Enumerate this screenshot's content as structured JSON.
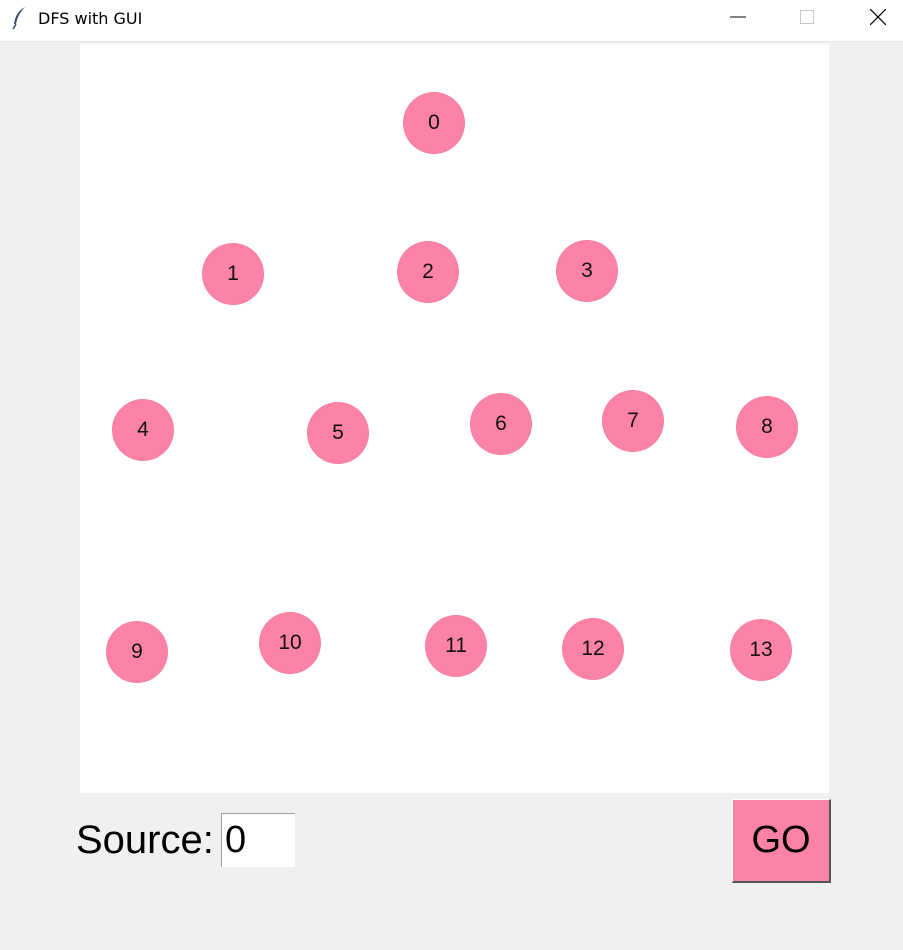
{
  "window": {
    "title": "DFS with GUI",
    "app_icon": "feather-icon",
    "controls": [
      "minimize-icon",
      "maximize-icon",
      "close-icon"
    ]
  },
  "graph": {
    "node_color": "#fd83a6",
    "canvas_color": "#ffffff",
    "nodes": [
      {
        "label": "0"
      },
      {
        "label": "1"
      },
      {
        "label": "2"
      },
      {
        "label": "3"
      },
      {
        "label": "4"
      },
      {
        "label": "5"
      },
      {
        "label": "6"
      },
      {
        "label": "7"
      },
      {
        "label": "8"
      },
      {
        "label": "9"
      },
      {
        "label": "10"
      },
      {
        "label": "11"
      },
      {
        "label": "12"
      },
      {
        "label": "13"
      }
    ]
  },
  "controls": {
    "source_label": "Source:",
    "source_value": "0",
    "go_label": "GO",
    "go_color": "#fd83a6"
  }
}
